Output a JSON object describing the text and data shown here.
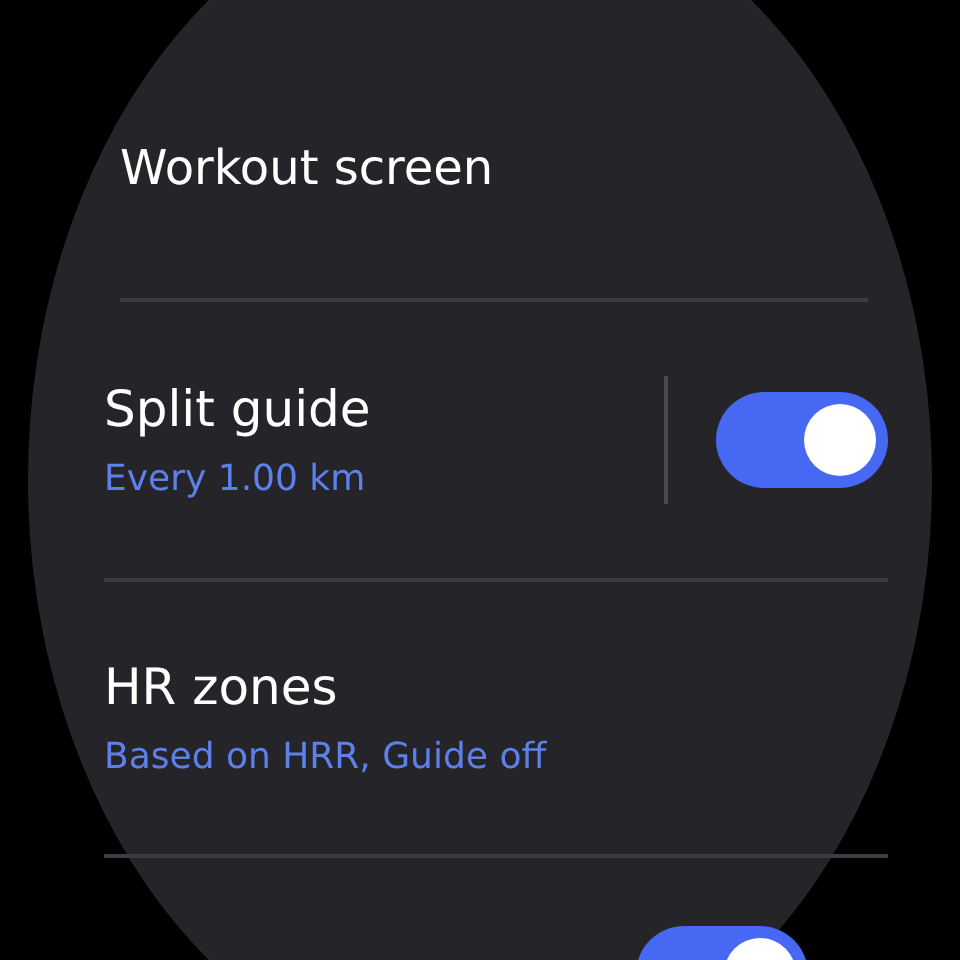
{
  "items": [
    {
      "kind": "title",
      "title": "Workout screen"
    },
    {
      "kind": "toggle",
      "title": "Split guide",
      "summary": "Every 1.00 km",
      "on": true
    },
    {
      "kind": "plain",
      "title": "HR zones",
      "summary": "Based on HRR, Guide off"
    },
    {
      "kind": "toggle_peek",
      "on": true
    }
  ]
}
